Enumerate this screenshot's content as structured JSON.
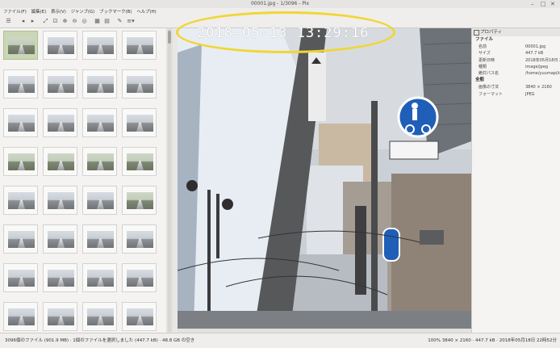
{
  "window": {
    "title": "00001.jpg - 1/3096 - Pix",
    "controls": [
      "–",
      "□",
      "✕"
    ]
  },
  "menu": [
    "ファイル(F)",
    "編集(E)",
    "表示(V)",
    "ジャンプ(G)",
    "ブックマーク(B)",
    "ヘルプ(H)"
  ],
  "toolbar": {
    "icons": [
      "menu-icon",
      "back-icon",
      "forward-icon",
      "fullscreen-icon",
      "zoom-fit-icon",
      "zoom-in-icon",
      "zoom-out-icon",
      "zoom-100-icon",
      "grid-view-icon",
      "list-view-icon",
      "edit-icon",
      "view-options-icon"
    ]
  },
  "viewer": {
    "timestamp": "2018-05-13 13:29:16"
  },
  "properties": {
    "title": "プロパティ",
    "file_section": "ファイル",
    "rows": [
      {
        "key": "名前",
        "value": "00001.jpg"
      },
      {
        "key": "サイズ",
        "value": "447.7 kB"
      },
      {
        "key": "更新日時",
        "value": "2018年05月18日 22時"
      },
      {
        "key": "種類",
        "value": "image/jpeg"
      },
      {
        "key": "絶対パス名",
        "value": "/home/yuumapi/img"
      }
    ],
    "general_section": "全般",
    "rows2": [
      {
        "key": "画像の寸法",
        "value": "3840 × 2160"
      },
      {
        "key": "フォーマット",
        "value": "JPEG"
      }
    ]
  },
  "status": {
    "left": "3096個のファイル (901.9 MB) · 1個のファイルを選択しました (447.7 kB) · 48.8 GB の空き",
    "right": "100%  3840 × 2160 · 447.7 kB · 2018年05月18日 22時52分"
  },
  "colors": {
    "highlight_ellipse": "#f0d634",
    "selected_thumb": "#c9d7b5",
    "sky": "#c9cdd2",
    "sign_blue": "#1f5fb8"
  }
}
